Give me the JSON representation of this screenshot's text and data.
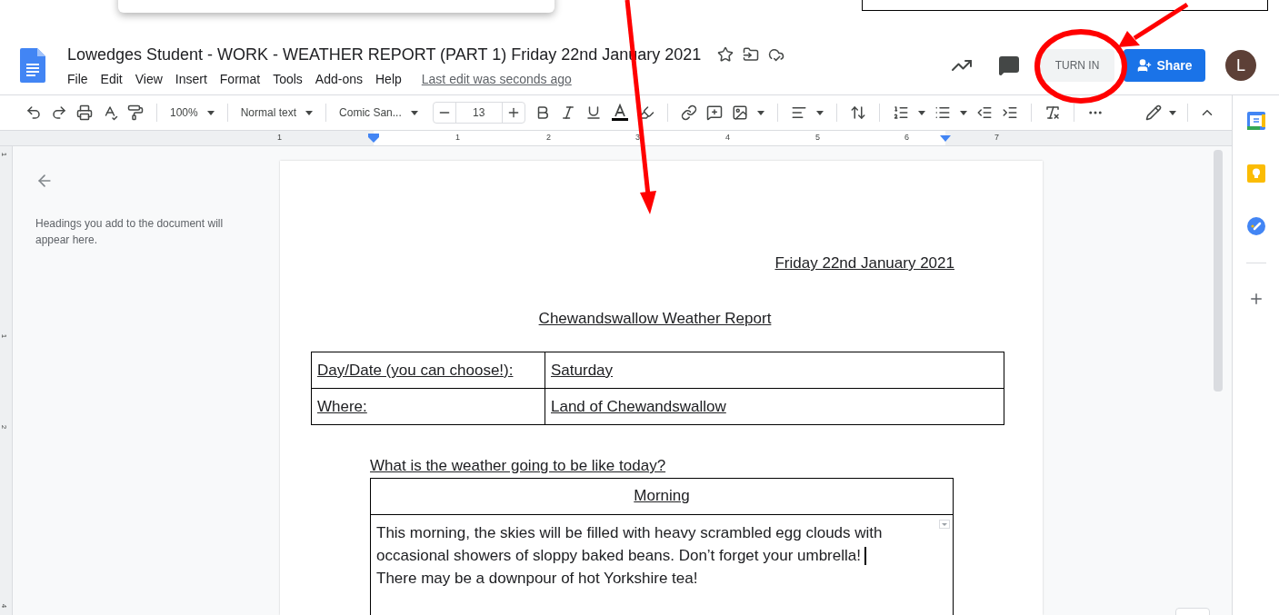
{
  "document": {
    "title": "Lowedges Student - WORK - WEATHER REPORT (PART 1) Friday 22nd January 2021",
    "last_edit": "Last edit was seconds ago"
  },
  "menu": [
    "File",
    "Edit",
    "View",
    "Insert",
    "Format",
    "Tools",
    "Add-ons",
    "Help"
  ],
  "header_buttons": {
    "turn_in": "TURN IN",
    "share": "Share",
    "avatar": "L"
  },
  "toolbar": {
    "zoom": "100%",
    "style": "Normal text",
    "font": "Comic San...",
    "font_size": "13"
  },
  "ruler": {
    "labels": [
      "1",
      "1",
      "2",
      "3",
      "4",
      "5",
      "6",
      "7"
    ],
    "vertical_labels": [
      "1",
      "1",
      "2",
      "4"
    ]
  },
  "outline": {
    "hint": "Headings you add to the document will appear here."
  },
  "page": {
    "date": "Friday 22nd January 2021",
    "heading": "Chewandswallow Weather Report",
    "info_table": [
      {
        "label": "Day/Date (you can choose!):",
        "value": "Saturday"
      },
      {
        "label": "Where:",
        "value": "Land of Chewandswallow"
      }
    ],
    "question": "What is the weather going to be like today?",
    "forecast": {
      "header": "Morning",
      "paragraphs": [
        {
          "text": "This morning, the skies will be filled with heavy scrambled egg clouds with occasional showers of sloppy baked beans. Don’t forget your umbrella!",
          "cursor": true
        },
        {
          "text": "There may be a downpour of hot Yorkshire tea!",
          "cursor": false
        }
      ]
    }
  }
}
